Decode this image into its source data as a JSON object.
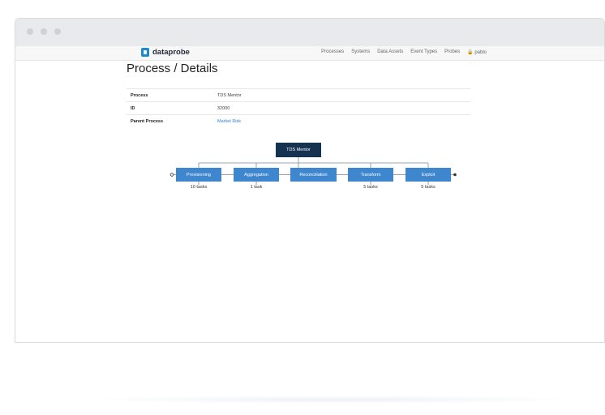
{
  "app": {
    "logo_text": "dataprobe"
  },
  "nav": {
    "items": [
      "Processes",
      "Systems",
      "Data Assets",
      "Event Types",
      "Probes"
    ],
    "user": "pablo"
  },
  "page": {
    "title": "Process / Details"
  },
  "details": [
    {
      "label": "Process",
      "value": "TDS Mentor"
    },
    {
      "label": "ID",
      "value": "32000"
    },
    {
      "label": "Parent Process",
      "value": "Market Risk"
    }
  ],
  "flow": {
    "root": "TDS Mentor",
    "steps": [
      {
        "name": "Provisioning",
        "count": "10 tasks"
      },
      {
        "name": "Aggregation",
        "count": "1 task"
      },
      {
        "name": "Reconciliation",
        "count": ""
      },
      {
        "name": "Transform",
        "count": "5 tasks"
      },
      {
        "name": "Exploit",
        "count": "5 tasks"
      }
    ]
  },
  "colors": {
    "root": "#153350",
    "step": "#3e86cd",
    "link": "#2f7fd1",
    "brand": "#1f8acb"
  }
}
